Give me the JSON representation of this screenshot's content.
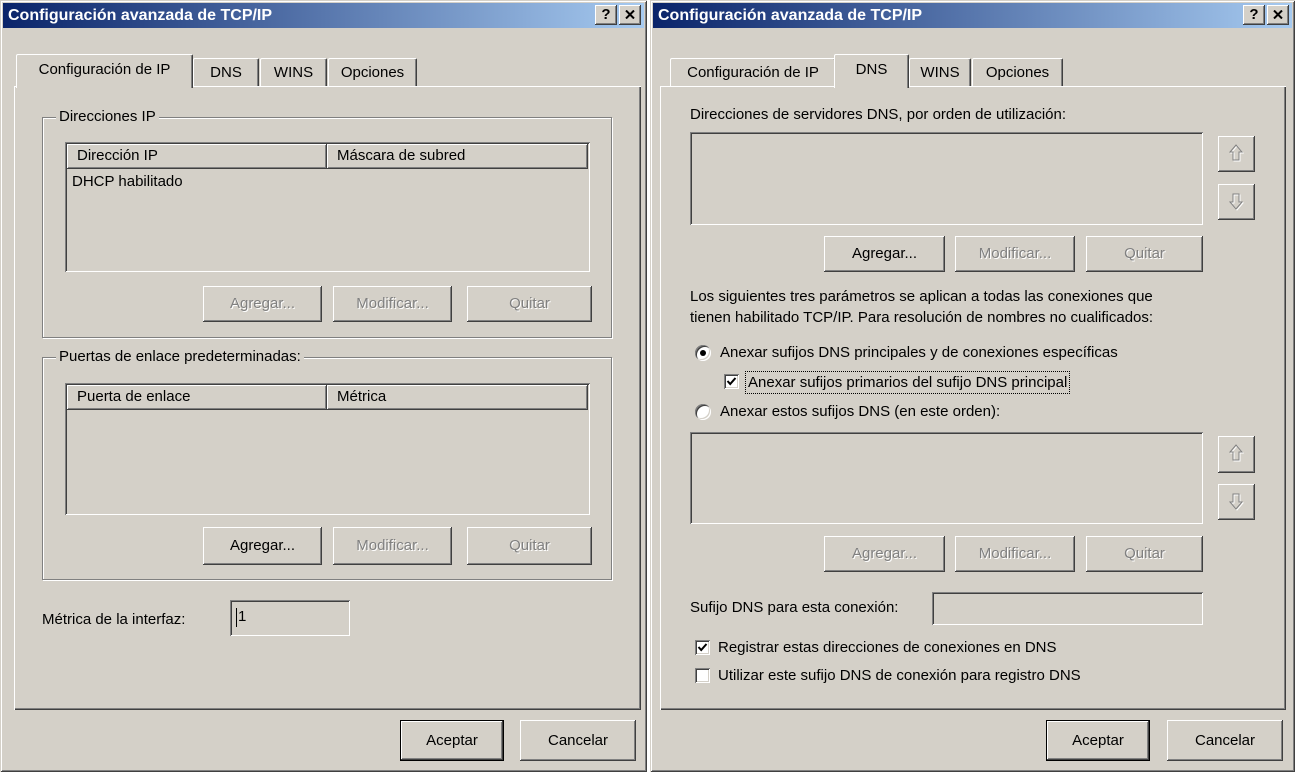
{
  "colors": {
    "face": "#D4D0C8",
    "title_start": "#0A246A",
    "title_end": "#A6CAF0",
    "disabled_text": "#808080"
  },
  "icons": {
    "close": "close-icon",
    "move_up": "arrow-up-icon",
    "move_down": "arrow-down-icon",
    "check": "check-icon"
  },
  "left_dialog": {
    "title": "Configuración avanzada de TCP/IP",
    "help_label": "?",
    "tabs": [
      "Configuración de IP",
      "DNS",
      "WINS",
      "Opciones"
    ],
    "selected_tab": 0,
    "ip_addresses": {
      "label": "Direcciones IP",
      "columns": [
        "Dirección IP",
        "Máscara de subred"
      ],
      "rows": [
        [
          "DHCP habilitado",
          ""
        ]
      ],
      "buttons": [
        {
          "label": "Agregar...",
          "enabled": false
        },
        {
          "label": "Modificar...",
          "enabled": false
        },
        {
          "label": "Quitar",
          "enabled": false
        }
      ]
    },
    "gateways": {
      "label": "Puertas de enlace predeterminadas:",
      "columns": [
        "Puerta de enlace",
        "Métrica"
      ],
      "rows": [],
      "buttons": [
        {
          "label": "Agregar...",
          "enabled": true
        },
        {
          "label": "Modificar...",
          "enabled": false
        },
        {
          "label": "Quitar",
          "enabled": false
        }
      ]
    },
    "interface_metric": {
      "label": "Métrica de la interfaz:",
      "value": "1"
    },
    "ok_label": "Aceptar",
    "cancel_label": "Cancelar"
  },
  "right_dialog": {
    "title": "Configuración avanzada de TCP/IP",
    "help_label": "?",
    "tabs": [
      "Configuración de IP",
      "DNS",
      "WINS",
      "Opciones"
    ],
    "selected_tab": 1,
    "dns_servers": {
      "label": "Direcciones de servidores DNS, por orden de utilización:",
      "items": [],
      "buttons": [
        {
          "label": "Agregar...",
          "enabled": true
        },
        {
          "label": "Modificar...",
          "enabled": false
        },
        {
          "label": "Quitar",
          "enabled": false
        }
      ]
    },
    "info_text": [
      "Los siguientes tres parámetros se aplican a todas las conexiones que",
      "tienen habilitado TCP/IP. Para resolución de nombres no cualificados:"
    ],
    "append_primary_suffixes": {
      "label": "Anexar sufijos DNS principales y de conexiones específicas",
      "selected": true
    },
    "append_parent_suffixes": {
      "label": "Anexar sufijos primarios del sufijo DNS principal",
      "checked": true
    },
    "append_these_suffixes": {
      "label": "Anexar estos sufijos DNS (en este orden):",
      "selected": false,
      "items": [],
      "buttons": [
        {
          "label": "Agregar...",
          "enabled": false
        },
        {
          "label": "Modificar...",
          "enabled": false
        },
        {
          "label": "Quitar",
          "enabled": false
        }
      ]
    },
    "connection_suffix": {
      "label": "Sufijo DNS para esta conexión:",
      "value": ""
    },
    "register_addresses": {
      "label": "Registrar estas direcciones de conexiones en DNS",
      "checked": true
    },
    "use_suffix_for_registration": {
      "label": "Utilizar este sufijo DNS de conexión para registro DNS",
      "checked": false
    },
    "ok_label": "Aceptar",
    "cancel_label": "Cancelar"
  }
}
